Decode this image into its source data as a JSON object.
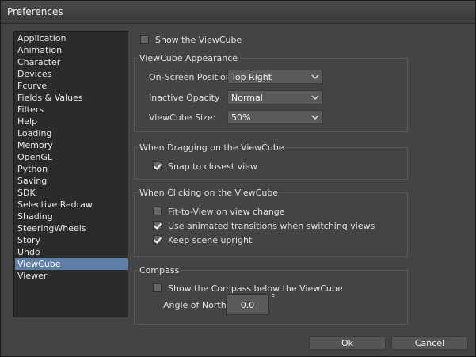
{
  "window": {
    "title": "Preferences"
  },
  "sidebar": {
    "items": [
      {
        "label": "Application"
      },
      {
        "label": "Animation"
      },
      {
        "label": "Character"
      },
      {
        "label": "Devices"
      },
      {
        "label": "Fcurve"
      },
      {
        "label": "Fields & Values"
      },
      {
        "label": "Filters"
      },
      {
        "label": "Help"
      },
      {
        "label": "Loading"
      },
      {
        "label": "Memory"
      },
      {
        "label": "OpenGL"
      },
      {
        "label": "Python"
      },
      {
        "label": "Saving"
      },
      {
        "label": "SDK"
      },
      {
        "label": "Selective Redraw"
      },
      {
        "label": "Shading"
      },
      {
        "label": "SteeringWheels"
      },
      {
        "label": "Story"
      },
      {
        "label": "Undo"
      },
      {
        "label": "ViewCube"
      },
      {
        "label": "Viewer"
      }
    ],
    "selected": "ViewCube"
  },
  "show_viewcube": {
    "label": "Show the ViewCube",
    "checked": false
  },
  "appearance": {
    "title": "ViewCube Appearance",
    "position": {
      "label": "On-Screen Position:",
      "value": "Top Right"
    },
    "opacity": {
      "label": "Inactive Opacity",
      "value": "Normal"
    },
    "size": {
      "label": "ViewCube Size:",
      "value": "50%"
    }
  },
  "dragging": {
    "title": "When Dragging on the ViewCube",
    "snap": {
      "label": "Snap to closest view",
      "checked": true
    }
  },
  "clicking": {
    "title": "When Clicking on the ViewCube",
    "fit": {
      "label": "Fit-to-View on view change",
      "checked": false
    },
    "animated": {
      "label": "Use animated transitions when switching views",
      "checked": true
    },
    "upright": {
      "label": "Keep scene upright",
      "checked": true
    }
  },
  "compass": {
    "title": "Compass",
    "show": {
      "label": "Show the Compass below the ViewCube",
      "checked": false
    },
    "north": {
      "label": "Angle of North:",
      "value": "0.0",
      "unit": "°"
    }
  },
  "buttons": {
    "ok": "Ok",
    "cancel": "Cancel"
  }
}
